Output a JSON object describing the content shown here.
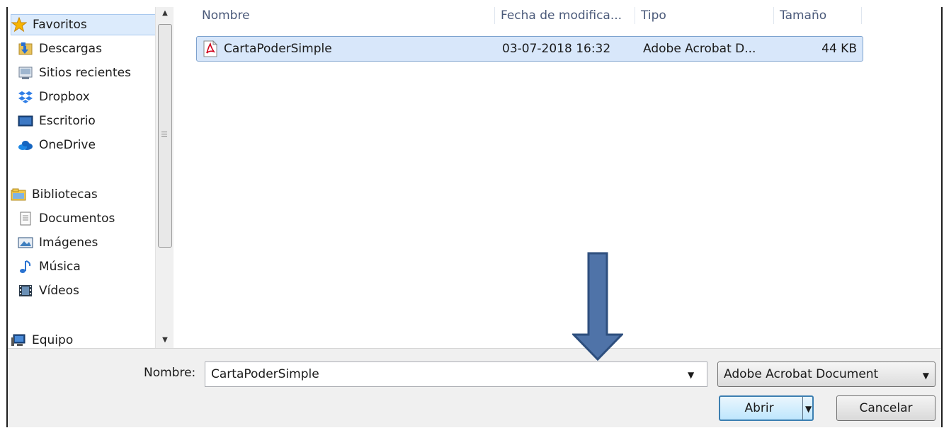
{
  "sidebar": {
    "items": [
      {
        "label": "Favoritos",
        "icon": "star-icon",
        "selected": true
      },
      {
        "label": "Descargas",
        "icon": "downloads-folder-icon"
      },
      {
        "label": "Sitios recientes",
        "icon": "recent-places-icon"
      },
      {
        "label": "Dropbox",
        "icon": "dropbox-icon"
      },
      {
        "label": "Escritorio",
        "icon": "desktop-icon"
      },
      {
        "label": "OneDrive",
        "icon": "onedrive-icon"
      },
      {
        "label": "Bibliotecas",
        "icon": "libraries-icon"
      },
      {
        "label": "Documentos",
        "icon": "documents-icon"
      },
      {
        "label": "Imágenes",
        "icon": "pictures-icon"
      },
      {
        "label": "Música",
        "icon": "music-icon"
      },
      {
        "label": "Vídeos",
        "icon": "videos-icon"
      },
      {
        "label": "Equipo",
        "icon": "computer-icon"
      }
    ]
  },
  "file_list": {
    "columns": [
      "Nombre",
      "Fecha de modifica...",
      "Tipo",
      "Tamaño"
    ],
    "rows": [
      {
        "name": "CartaPoderSimple",
        "date": "03-07-2018 16:32",
        "type": "Adobe Acrobat D...",
        "size": "44 KB",
        "icon": "pdf-file-icon"
      }
    ]
  },
  "bottom": {
    "name_label": "Nombre:",
    "name_value": "CartaPoderSimple",
    "file_type": "Adobe Acrobat Document",
    "open_label": "Abrir",
    "cancel_label": "Cancelar"
  },
  "colors": {
    "selection": "#d8e7fa",
    "selection_border": "#7da2ce",
    "arrow_fill": "#4f73a8",
    "arrow_stroke": "#2e4f7e"
  }
}
